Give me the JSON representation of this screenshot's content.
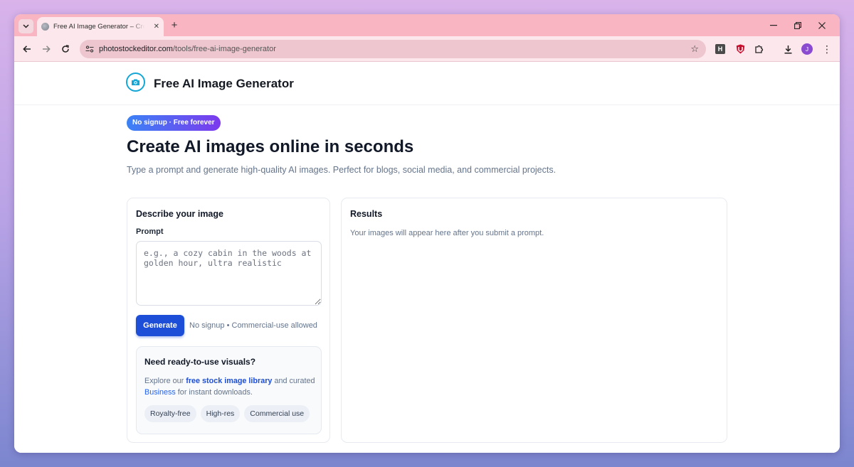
{
  "browser": {
    "tab_title": "Free AI Image Generator – Create AI images online",
    "new_tab_symbol": "+",
    "url_host": "photostockeditor.com",
    "url_path": "/tools/free-ai-image-generator",
    "extension_h_label": "H",
    "avatar_initial": "J"
  },
  "site": {
    "title": "Free AI Image Generator"
  },
  "hero": {
    "badge": "No signup · Free forever",
    "title": "Create AI images online in seconds",
    "subtitle": "Type a prompt and generate high-quality AI images. Perfect for blogs, social media, and commercial projects."
  },
  "form": {
    "card_title": "Describe your image",
    "prompt_label": "Prompt",
    "prompt_placeholder": "e.g., a cozy cabin in the woods at golden hour, ultra realistic",
    "prompt_value": "",
    "generate_label": "Generate",
    "generate_note": "No signup • Commercial-use allowed"
  },
  "promo": {
    "title": "Need ready-to-use visuals?",
    "text_prefix": "Explore our ",
    "link_library": "free stock image library",
    "text_middle": " and curated ",
    "link_business": "Business",
    "text_suffix": " for instant downloads.",
    "chips": [
      "Royalty-free",
      "High-res",
      "Commercial use"
    ]
  },
  "results": {
    "title": "Results",
    "empty_text": "Your images will appear here after you submit a prompt."
  },
  "colors": {
    "tabstrip": "#f9b5c2",
    "toolbar": "#fce7ec",
    "accent": "#1d4ed8",
    "logo": "#14a7d6"
  }
}
